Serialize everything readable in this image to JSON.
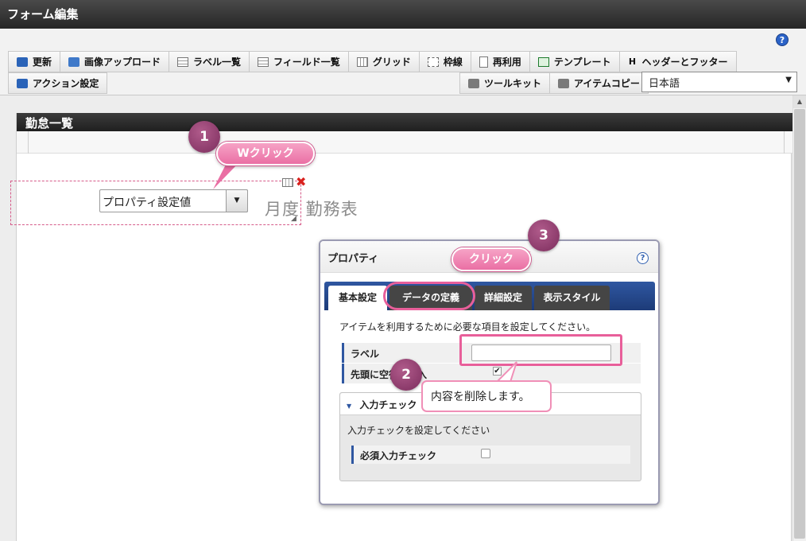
{
  "window": {
    "title": "フォーム編集"
  },
  "toolbar": {
    "help_icon": "?",
    "row1": [
      {
        "label": "更新",
        "icon": "update-icon"
      },
      {
        "label": "画像アップロード",
        "icon": "image-upload-icon"
      },
      {
        "label": "ラベル一覧",
        "icon": "label-list-icon"
      },
      {
        "label": "フィールド一覧",
        "icon": "field-list-icon"
      },
      {
        "label": "グリッド",
        "icon": "grid-icon"
      },
      {
        "label": "枠線",
        "icon": "border-icon"
      },
      {
        "label": "再利用",
        "icon": "reuse-icon"
      },
      {
        "label": "テンプレート",
        "icon": "template-icon"
      },
      {
        "label": "ヘッダーとフッター",
        "icon": "header-footer-icon"
      }
    ],
    "action_label": "アクション設定",
    "toolkit_label": "ツールキット",
    "item_copy_label": "アイテムコピー",
    "language": "日本語"
  },
  "sheet": {
    "title": "勤怠一覧"
  },
  "item": {
    "select_value": "プロパティ設定値",
    "ghost_title": "月度 勤務表"
  },
  "dialog": {
    "title": "プロパティ",
    "help": "?",
    "tabs": [
      "基本設定",
      "データの定義",
      "詳細設定",
      "表示スタイル"
    ],
    "description": "アイテムを利用するために必要な項目を設定してください。",
    "label_field": {
      "label": "ラベル",
      "value": ""
    },
    "blank_row_label": "先頭に空行を挿入",
    "input_check": {
      "header": "入力チェック",
      "description": "入力チェックを設定してください",
      "required_label": "必須入力チェック"
    }
  },
  "annotations": {
    "step1": "1",
    "step1_label": "Wクリック",
    "step2": "2",
    "step2_label": "内容を削除します。",
    "step3": "3",
    "step3_label": "クリック"
  },
  "colors": {
    "accent": "#e85f9a",
    "tab_blue": "#2f57a1",
    "badge": "#7c2d5d"
  }
}
